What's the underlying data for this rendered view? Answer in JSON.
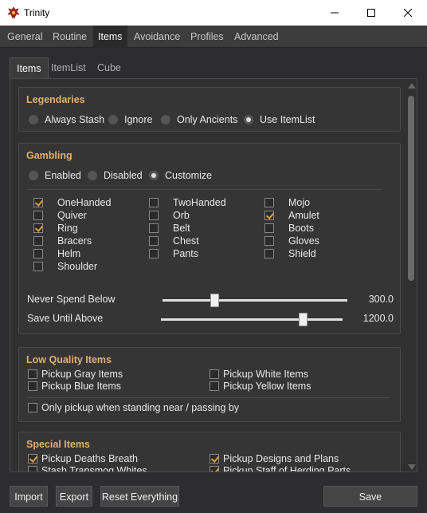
{
  "window": {
    "title": "Trinity"
  },
  "main_tabs": [
    "General",
    "Routine",
    "Items",
    "Avoidance",
    "Profiles",
    "Advanced"
  ],
  "sub_tabs": [
    "Items",
    "ItemList",
    "Cube"
  ],
  "legendaries": {
    "title": "Legendaries",
    "options": [
      "Always Stash",
      "Ignore",
      "Only Ancients",
      "Use ItemList"
    ],
    "selected": "Use ItemList"
  },
  "gambling": {
    "title": "Gambling",
    "options": [
      "Enabled",
      "Disabled",
      "Customize"
    ],
    "selected": "Customize",
    "items": [
      {
        "label": "OneHanded",
        "checked": true
      },
      {
        "label": "TwoHanded",
        "checked": false
      },
      {
        "label": "Mojo",
        "checked": false
      },
      {
        "label": "Quiver",
        "checked": false
      },
      {
        "label": "Orb",
        "checked": false
      },
      {
        "label": "Amulet",
        "checked": true
      },
      {
        "label": "Ring",
        "checked": true
      },
      {
        "label": "Belt",
        "checked": false
      },
      {
        "label": "Boots",
        "checked": false
      },
      {
        "label": "Bracers",
        "checked": false
      },
      {
        "label": "Chest",
        "checked": false
      },
      {
        "label": "Gloves",
        "checked": false
      },
      {
        "label": "Helm",
        "checked": false
      },
      {
        "label": "Pants",
        "checked": false
      },
      {
        "label": "Shield",
        "checked": false
      },
      {
        "label": "Shoulder",
        "checked": false
      }
    ],
    "never_spend_below": {
      "label": "Never Spend Below",
      "value": "300.0",
      "fraction": 0.28
    },
    "save_until_above": {
      "label": "Save Until Above",
      "value": "1200.0",
      "fraction": 0.78
    }
  },
  "low_quality": {
    "title": "Low Quality Items",
    "items": [
      {
        "label": "Pickup Gray Items",
        "checked": false
      },
      {
        "label": "Pickup White Items",
        "checked": false
      },
      {
        "label": "Pickup Blue Items",
        "checked": false
      },
      {
        "label": "Pickup Yellow Items",
        "checked": false
      }
    ],
    "near_only": {
      "label": "Only pickup when standing near / passing by",
      "checked": false
    }
  },
  "special": {
    "title": "Special Items",
    "items": [
      {
        "label": "Pickup Deaths Breath",
        "checked": true
      },
      {
        "label": "Pickup Designs and Plans",
        "checked": true
      },
      {
        "label": "Stash Transmog Whites",
        "checked": false
      },
      {
        "label": "Pickup Staff of Herding Parts",
        "checked": true
      }
    ]
  },
  "buttons": {
    "import": "Import",
    "export": "Export",
    "reset": "Reset Everything",
    "save": "Save"
  }
}
